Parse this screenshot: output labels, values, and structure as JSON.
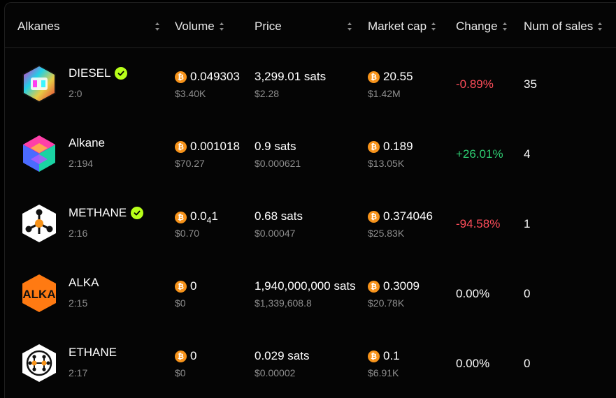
{
  "columns": {
    "alkanes": "Alkanes",
    "volume": "Volume",
    "price": "Price",
    "market_cap": "Market cap",
    "change": "Change",
    "num_sales": "Num of sales"
  },
  "rows": [
    {
      "name": "DIESEL",
      "id": "2:0",
      "verified": true,
      "volume_btc": "0.049303",
      "volume_usd": "$3.40K",
      "price": "3,299.01 sats",
      "price_usd": "$2.28",
      "mcap_btc": "20.55",
      "mcap_usd": "$1.42M",
      "change": "-0.89%",
      "sales": "35"
    },
    {
      "name": "Alkane",
      "id": "2:194",
      "verified": false,
      "volume_btc": "0.001018",
      "volume_usd": "$70.27",
      "price": "0.9 sats",
      "price_usd": "$0.000621",
      "mcap_btc": "0.189",
      "mcap_usd": "$13.05K",
      "change": "+26.01%",
      "sales": "4"
    },
    {
      "name": "METHANE",
      "id": "2:16",
      "verified": true,
      "volume_btc_main": "0.0",
      "volume_btc_sub": "4",
      "volume_btc_tail": "1",
      "volume_usd": "$0.70",
      "price": "0.68 sats",
      "price_usd": "$0.00047",
      "mcap_btc": "0.374046",
      "mcap_usd": "$25.83K",
      "change": "-94.58%",
      "sales": "1"
    },
    {
      "name": "ALKA",
      "id": "2:15",
      "verified": false,
      "logo_text": "ALKA",
      "volume_btc": "0",
      "volume_usd": "$0",
      "price": "1,940,000,000 sats",
      "price_usd": "$1,339,608.8",
      "mcap_btc": "0.3009",
      "mcap_usd": "$20.78K",
      "change": "0.00%",
      "sales": "0"
    },
    {
      "name": "ETHANE",
      "id": "2:17",
      "verified": false,
      "volume_btc": "0",
      "volume_usd": "$0",
      "price": "0.029 sats",
      "price_usd": "$0.00002",
      "mcap_btc": "0.1",
      "mcap_usd": "$6.91K",
      "change": "0.00%",
      "sales": "0"
    }
  ],
  "colors": {
    "negative": "#ff4d5a",
    "positive": "#2ecc71",
    "bitcoin": "#f7931a",
    "verified": "#b8ff1a"
  }
}
